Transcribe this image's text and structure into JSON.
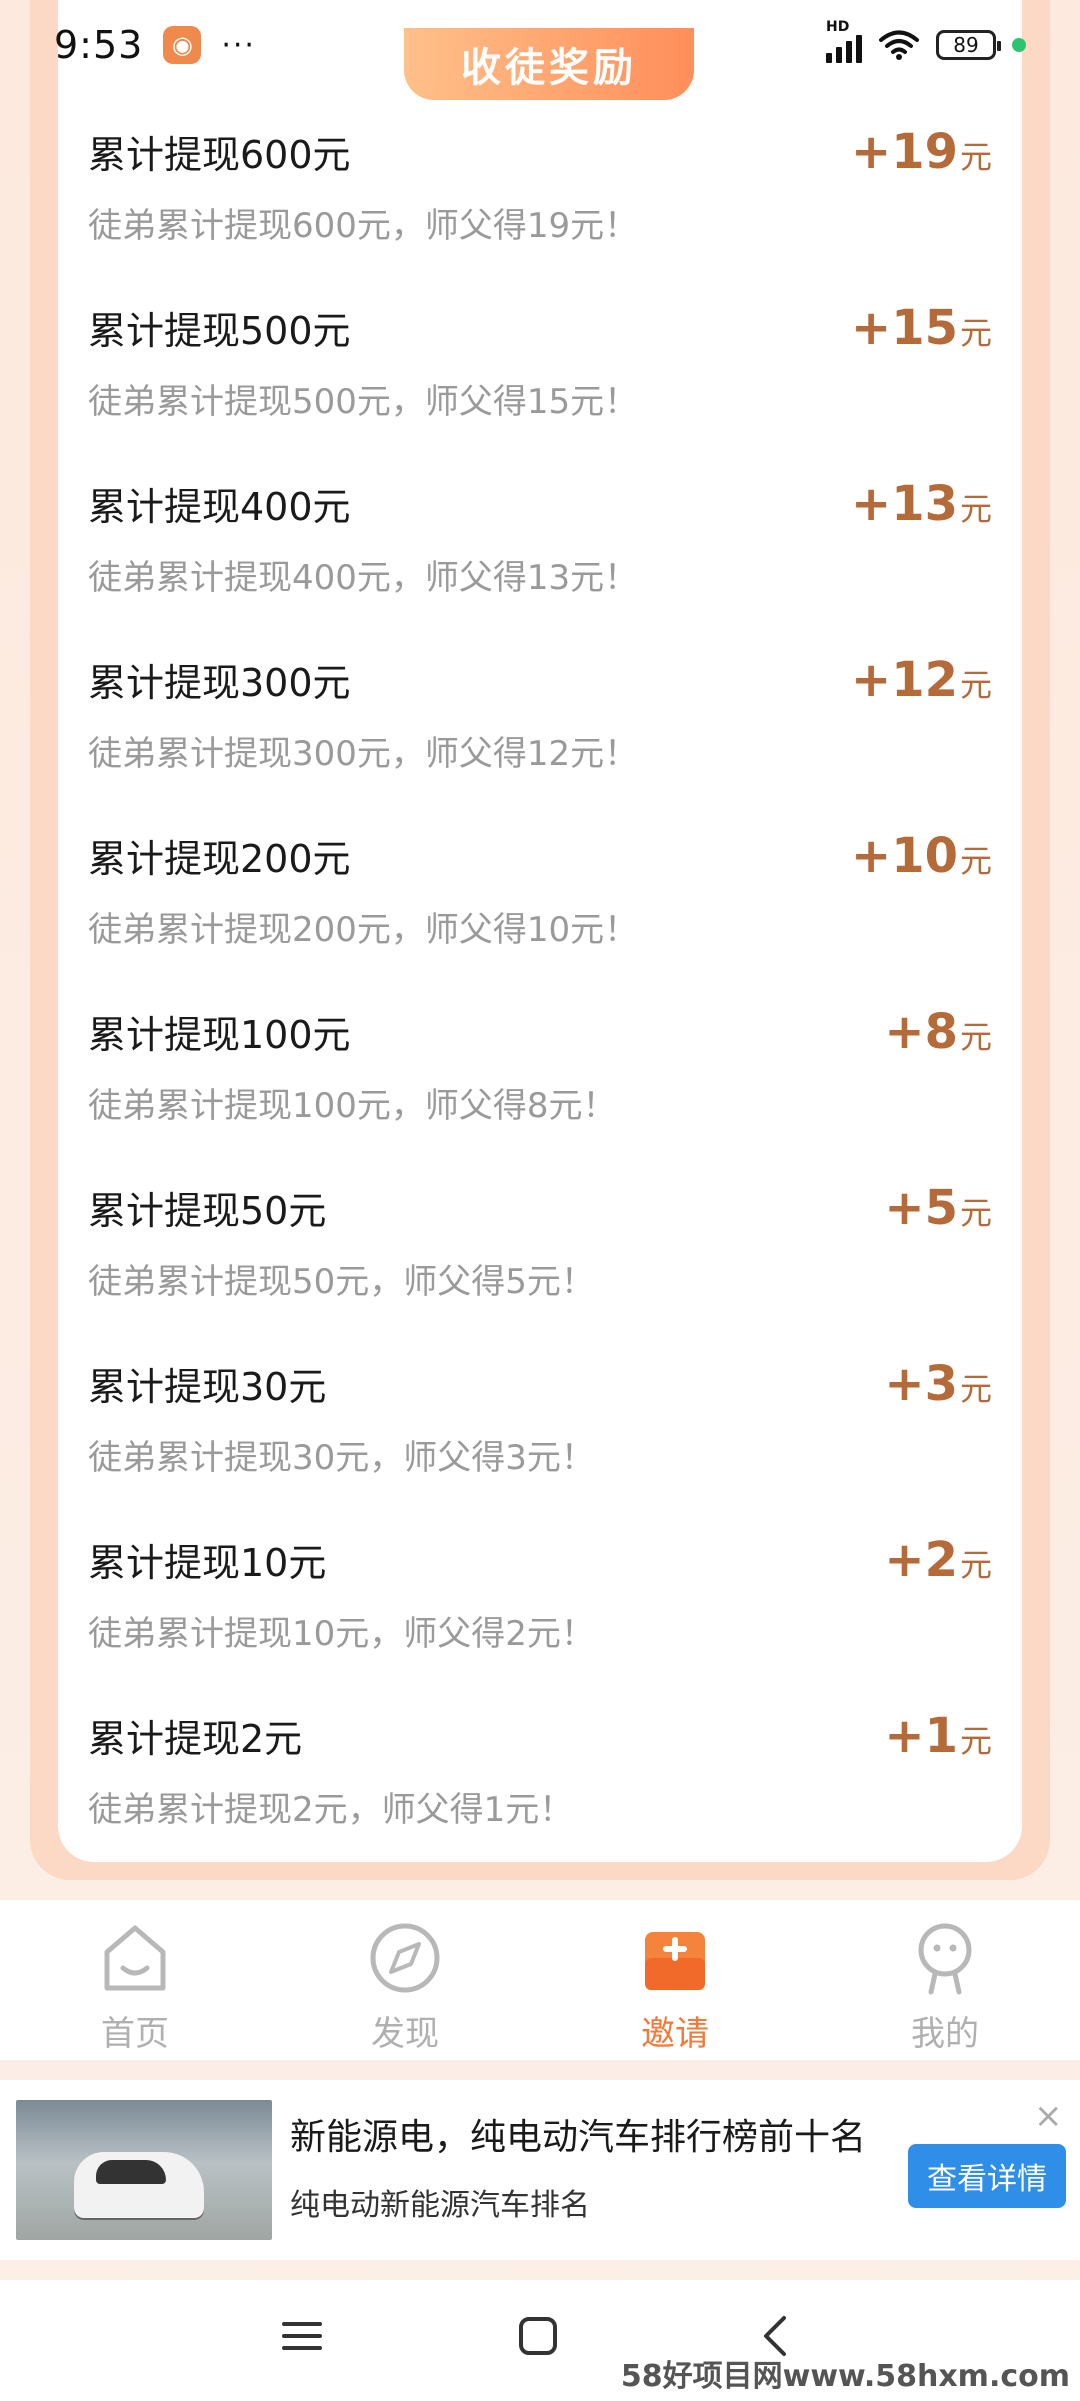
{
  "status_bar": {
    "time": "9:53",
    "more": "···",
    "network": "HD",
    "battery": "89"
  },
  "card": {
    "badge": "收徒奖励"
  },
  "rewards": [
    {
      "title": "累计提现600元",
      "desc": "徒弟累计提现600元，师父得19元！",
      "amount": "+19",
      "unit": "元"
    },
    {
      "title": "累计提现500元",
      "desc": "徒弟累计提现500元，师父得15元！",
      "amount": "+15",
      "unit": "元"
    },
    {
      "title": "累计提现400元",
      "desc": "徒弟累计提现400元，师父得13元！",
      "amount": "+13",
      "unit": "元"
    },
    {
      "title": "累计提现300元",
      "desc": "徒弟累计提现300元，师父得12元！",
      "amount": "+12",
      "unit": "元"
    },
    {
      "title": "累计提现200元",
      "desc": "徒弟累计提现200元，师父得10元！",
      "amount": "+10",
      "unit": "元"
    },
    {
      "title": "累计提现100元",
      "desc": "徒弟累计提现100元，师父得8元！",
      "amount": "+8",
      "unit": "元"
    },
    {
      "title": "累计提现50元",
      "desc": "徒弟累计提现50元，师父得5元！",
      "amount": "+5",
      "unit": "元"
    },
    {
      "title": "累计提现30元",
      "desc": "徒弟累计提现30元，师父得3元！",
      "amount": "+3",
      "unit": "元"
    },
    {
      "title": "累计提现10元",
      "desc": "徒弟累计提现10元，师父得2元！",
      "amount": "+2",
      "unit": "元"
    },
    {
      "title": "累计提现2元",
      "desc": "徒弟累计提现2元，师父得1元！",
      "amount": "+1",
      "unit": "元"
    }
  ],
  "bottom_nav": {
    "items": [
      {
        "label": "首页",
        "icon": "home-icon"
      },
      {
        "label": "发现",
        "icon": "compass-icon"
      },
      {
        "label": "邀请",
        "icon": "invite-icon",
        "active": true
      },
      {
        "label": "我的",
        "icon": "profile-icon"
      }
    ]
  },
  "ad": {
    "title": "新能源电，纯电动汽车排行榜前十名",
    "subtitle": "纯电动新能源汽车排名",
    "button": "查看详情",
    "close": "×"
  },
  "watermark": "58好项目网www.58hxm.com",
  "colors": {
    "accent": "#f07a3a",
    "amount": "#b56a3a",
    "ad_button": "#2f8fe8"
  }
}
